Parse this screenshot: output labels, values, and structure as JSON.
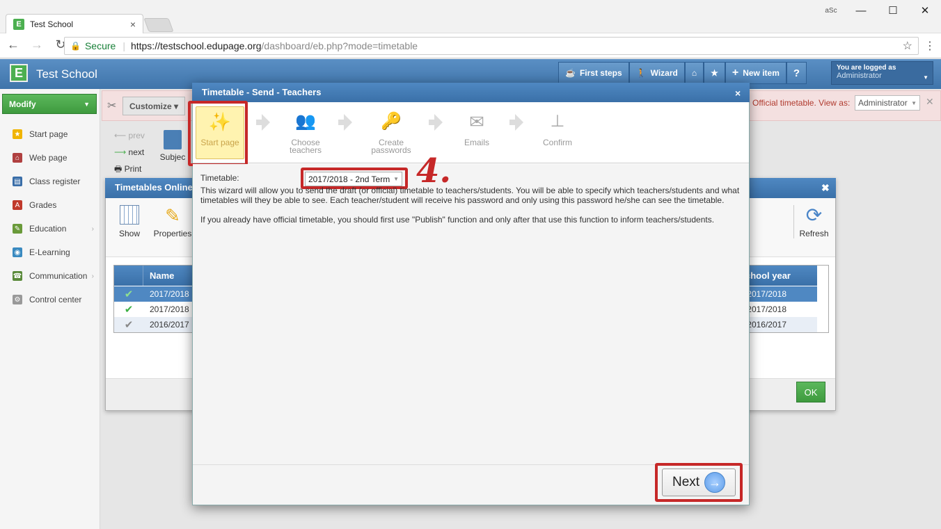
{
  "browser": {
    "tab_title": "Test School",
    "tab_close": "×",
    "window_badge": "aSc",
    "minimize": "—",
    "maximize": "☐",
    "close": "✕",
    "secure_label": "Secure",
    "url_host": "https://testschool.edupage.org",
    "url_path": "/dashboard/eb.php?mode=timetable"
  },
  "app": {
    "logo_letter": "E",
    "name": "Test School",
    "header_buttons": [
      "First steps",
      "Wizard"
    ],
    "logged_in_label": "You are logged as",
    "logged_in_user": "Administrator"
  },
  "sidebar": {
    "modify_label": "Modify",
    "items": [
      {
        "label": "Start page",
        "icon": "star-icon",
        "color": "#f0b400"
      },
      {
        "label": "Web page",
        "icon": "web-icon",
        "color": "#b04040"
      },
      {
        "label": "Class register",
        "icon": "book-icon",
        "color": "#3a6ea8"
      },
      {
        "label": "Grades",
        "icon": "grades-icon",
        "color": "#c0392b"
      },
      {
        "label": "Education",
        "icon": "education-icon",
        "color": "#6a9a3a"
      },
      {
        "label": "E-Learning",
        "icon": "elearning-icon",
        "color": "#3a8ac0"
      },
      {
        "label": "Communication",
        "icon": "communication-icon",
        "color": "#5a8a3a"
      },
      {
        "label": "Control center",
        "icon": "gear-icon",
        "color": "#999999"
      }
    ]
  },
  "customize": {
    "label": "Customize ▾",
    "official_text": "Official timetable.  View as:",
    "view_as": "Administrator"
  },
  "nav": {
    "prev": "prev",
    "next": "next",
    "print": "Print",
    "subjects": "Subjec"
  },
  "timetables_window": {
    "title": "Timetables Online",
    "show": "Show",
    "properties": "Properties",
    "refresh": "Refresh",
    "col_name": "Name",
    "col_school_year": "School year",
    "rows": [
      {
        "name": "2017/2018",
        "year": "2017/2018"
      },
      {
        "name": "2017/2018",
        "year": "2017/2018"
      },
      {
        "name": "2016/2017",
        "year": "2016/2017"
      }
    ],
    "ok": "OK"
  },
  "modal": {
    "title": "Timetable - Send - Teachers",
    "close": "×",
    "steps": [
      {
        "label": "Start page",
        "icon": "magic-wand-icon"
      },
      {
        "label": "Choose teachers",
        "icon": "teachers-icon"
      },
      {
        "label": "Create passwords",
        "icon": "passwords-icon"
      },
      {
        "label": "Emails",
        "icon": "email-icon"
      },
      {
        "label": "Confirm",
        "icon": "stamp-icon"
      }
    ],
    "timetable_label": "Timetable:",
    "timetable_value": "2017/2018 - 2nd Term",
    "annotation": "4.",
    "description_1": "This wizard will allow you to send the draft (or official) timetable to teachers/students. You will be able to specify which teachers/students and what timetables will they be able to see. Each teacher/student will receive his password and only using this password he/she can see the timetable.",
    "description_2": "If you already have official timetable, you should first use \"Publish\" function and only after that use this function to inform teachers/students.",
    "next_label": "Next"
  },
  "colors": {
    "header_blue": "#3f74aa",
    "highlight_red": "#c62828",
    "green": "#4caf50"
  }
}
